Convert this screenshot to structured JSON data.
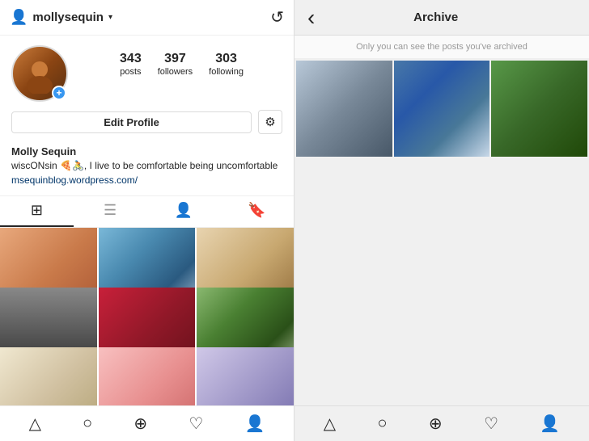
{
  "left": {
    "topbar": {
      "username": "mollysequin",
      "chevron": "▾",
      "person_icon": "👤",
      "clock_icon": "⟳"
    },
    "profile": {
      "stats": [
        {
          "number": "343",
          "label": "posts"
        },
        {
          "number": "397",
          "label": "followers"
        },
        {
          "number": "303",
          "label": "following"
        }
      ],
      "edit_btn": "Edit Profile",
      "name": "Molly Sequin",
      "bio": "wiscONsin 🍕🚴, I live to be comfortable being uncomfortable",
      "link": "msequinblog.wordpress.com/"
    },
    "tabs": [
      {
        "id": "grid",
        "active": true
      },
      {
        "id": "list",
        "active": false
      },
      {
        "id": "person",
        "active": false
      },
      {
        "id": "bookmark",
        "active": false
      }
    ]
  },
  "right": {
    "header": {
      "back_icon": "‹",
      "title": "Archive",
      "notice": "Only you can see the posts you've archived"
    }
  },
  "bottom_nav_left": [
    "⌃",
    "⊕",
    "♡",
    "👤"
  ],
  "bottom_nav_right": [
    "⌃",
    "⊕",
    "♡",
    "👤"
  ]
}
